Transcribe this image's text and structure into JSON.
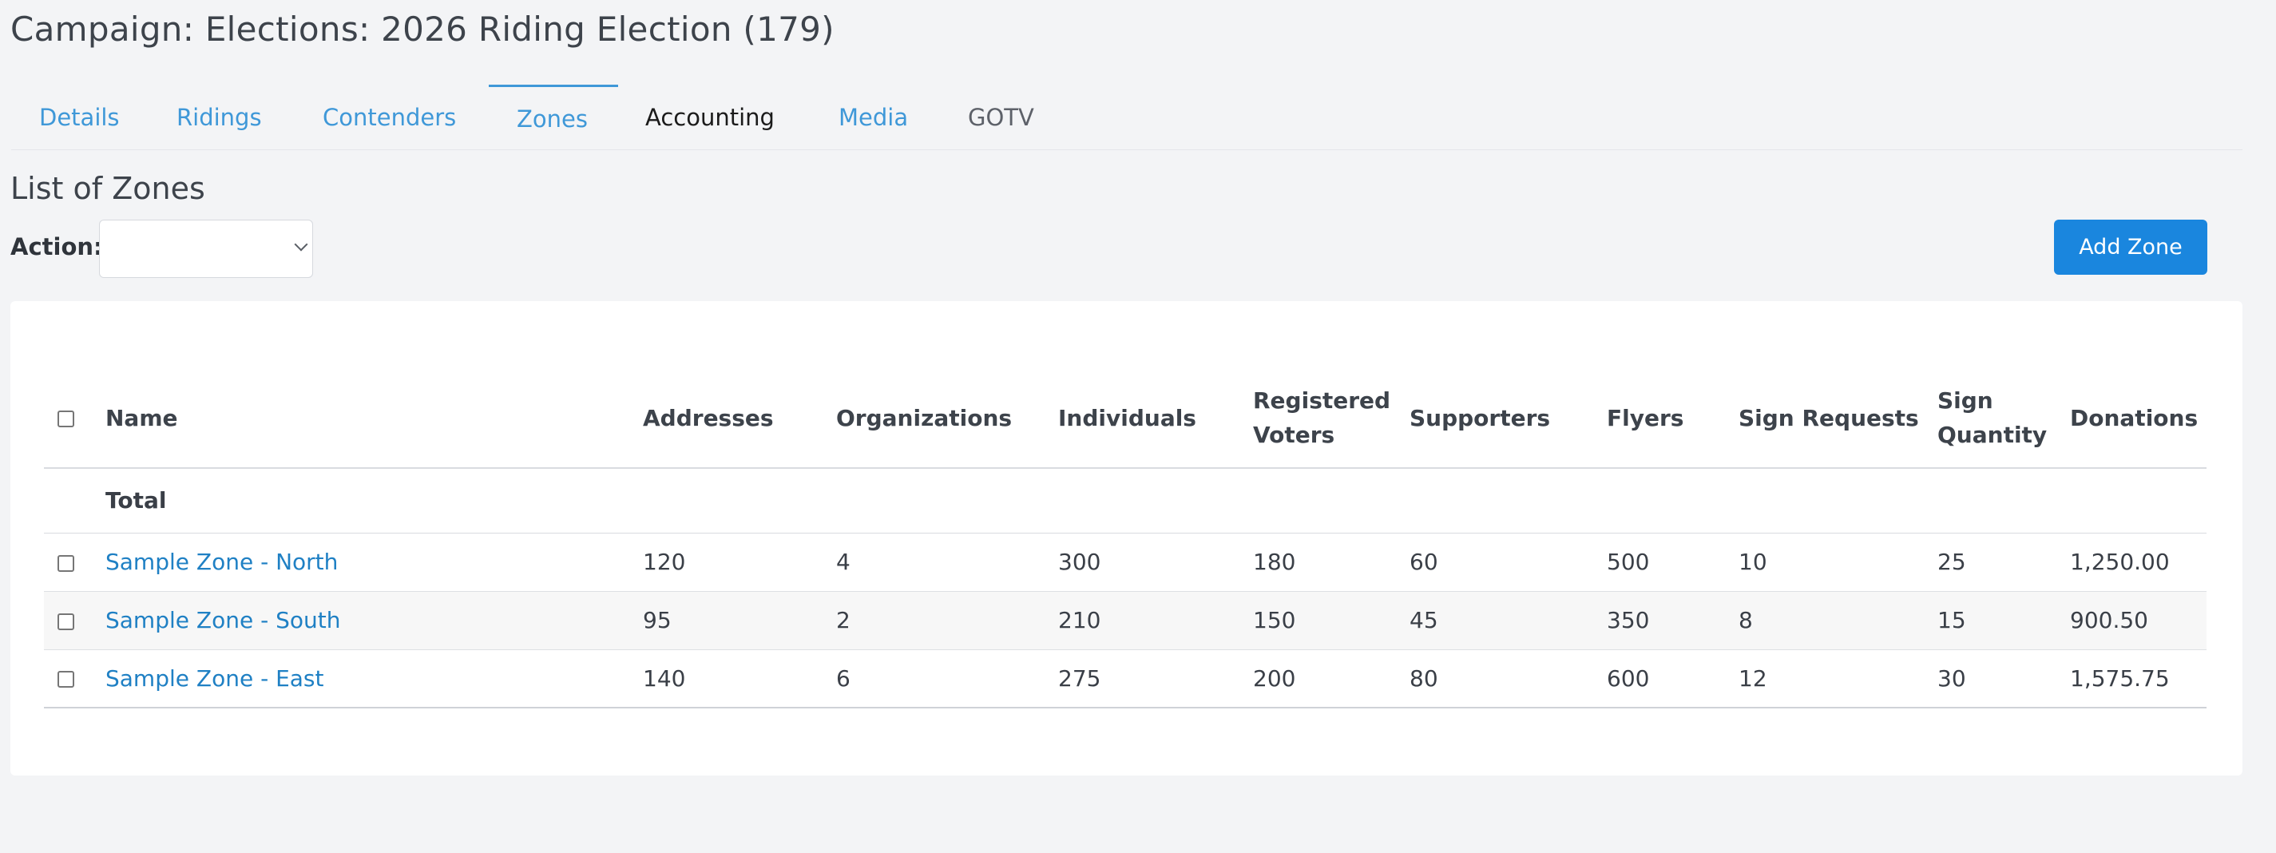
{
  "page": {
    "title": "Campaign: Elections: 2026 Riding Election (179)"
  },
  "tabs": [
    {
      "label": "Details"
    },
    {
      "label": "Ridings"
    },
    {
      "label": "Contenders"
    },
    {
      "label": "Zones",
      "active": true
    },
    {
      "label": "Accounting"
    },
    {
      "label": "Media"
    },
    {
      "label": "GOTV"
    }
  ],
  "section": {
    "title": "List of Zones",
    "action_label": "Action:",
    "action_value": "",
    "add_button_label": "Add Zone"
  },
  "icons": {
    "select_arrow": "chevron-down-icon",
    "checkbox": "checkbox-icon"
  },
  "colors": {
    "accent": "#1a86de",
    "link": "#1f80c4",
    "tab_link": "#3f98d8",
    "background": "#f3f4f6"
  },
  "table": {
    "headers": {
      "name": "Name",
      "addresses": "Addresses",
      "organizations": "Organizations",
      "individuals": "Individuals",
      "registered_voters_1": "Registered",
      "registered_voters_2": "Voters",
      "supporters": "Supporters",
      "flyers": "Flyers",
      "sign_requests": "Sign Requests",
      "sign_quantity_1": "Sign",
      "sign_quantity_2": "Quantity",
      "donations": "Donations"
    },
    "total_label": "Total",
    "rows": [
      {
        "name": "Sample Zone - North",
        "addresses": "120",
        "organizations": "4",
        "individuals": "300",
        "registered_voters": "180",
        "supporters": "60",
        "flyers": "500",
        "sign_requests": "10",
        "sign_quantity": "25",
        "donations": "1,250.00"
      },
      {
        "name": "Sample Zone - South",
        "addresses": "95",
        "organizations": "2",
        "individuals": "210",
        "registered_voters": "150",
        "supporters": "45",
        "flyers": "350",
        "sign_requests": "8",
        "sign_quantity": "15",
        "donations": "900.50"
      },
      {
        "name": "Sample Zone - East",
        "addresses": "140",
        "organizations": "6",
        "individuals": "275",
        "registered_voters": "200",
        "supporters": "80",
        "flyers": "600",
        "sign_requests": "12",
        "sign_quantity": "30",
        "donations": "1,575.75"
      }
    ]
  }
}
